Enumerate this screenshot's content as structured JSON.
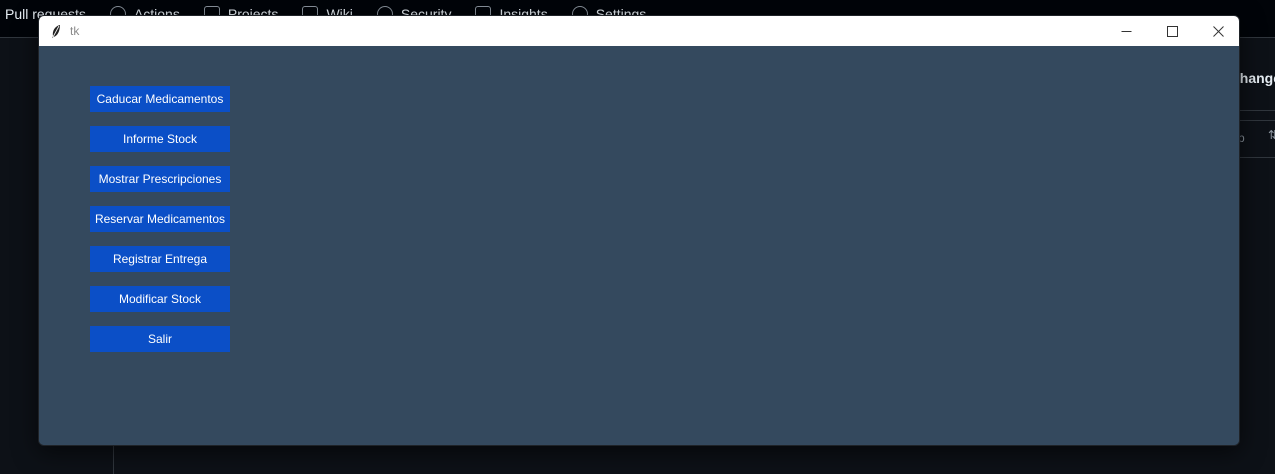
{
  "background": {
    "nav_tabs": [
      {
        "label": "Pull requests",
        "icon": "none"
      },
      {
        "label": "Actions",
        "icon": "play-circle-icon"
      },
      {
        "label": "Projects",
        "icon": "table-icon"
      },
      {
        "label": "Wiki",
        "icon": "book-icon"
      },
      {
        "label": "Security",
        "icon": "shield-icon"
      },
      {
        "label": "Insights",
        "icon": "graph-icon"
      },
      {
        "label": "Settings",
        "icon": "gear-icon"
      }
    ],
    "right_header": "changes",
    "right_row": "p"
  },
  "window": {
    "title": "tk",
    "controls": {
      "minimize": "minimize-icon",
      "maximize": "maximize-icon",
      "close": "close-icon"
    }
  },
  "buttons": [
    "Caducar Medicamentos",
    "Informe Stock",
    "Mostrar Prescripciones",
    "Reservar Medicamentos",
    "Registrar Entrega",
    "Modificar Stock",
    "Salir"
  ],
  "colors": {
    "window_bg": "#34495e",
    "button_bg": "#0b4fc7",
    "button_text": "#ffffff",
    "titlebar_bg": "#ffffff"
  }
}
